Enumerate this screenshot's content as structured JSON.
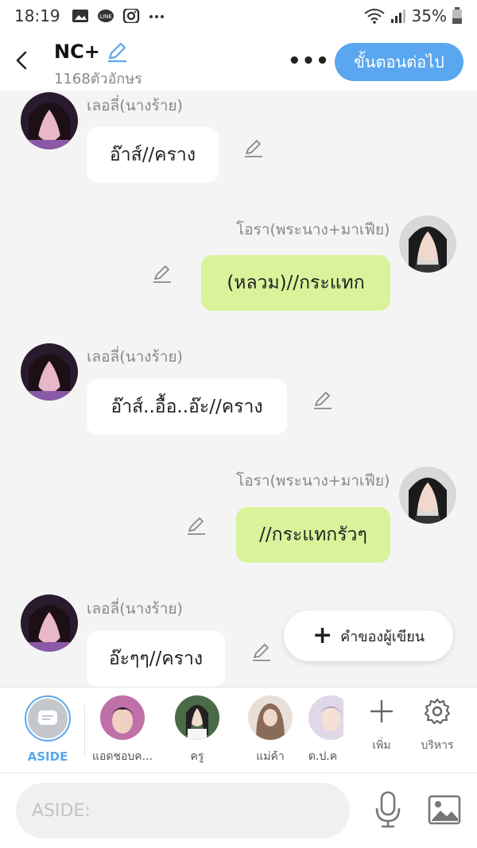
{
  "status_bar": {
    "time": "18:19",
    "battery": "35%",
    "icons": [
      "gallery-icon",
      "line-icon",
      "instagram-icon",
      "more-dots-icon",
      "wifi-icon",
      "signal-icon",
      "battery-icon"
    ]
  },
  "header": {
    "title": "NC+",
    "char_count": "1168ตัวอักษร",
    "more_label": "•••",
    "next_button": "ขั้นตอนต่อไป",
    "accent_color": "#5aa7ef"
  },
  "messages": [
    {
      "sender": "เลอลี่(นางร้าย)",
      "side": "left",
      "text": "อ๊าส์//คราง"
    },
    {
      "sender": "โอรา(พระนาง+มาเฟีย)",
      "side": "right",
      "text": "(หลวม)//กระแทก"
    },
    {
      "sender": "เลอลี่(นางร้าย)",
      "side": "left",
      "text": "อ๊าส์..อื้อ..อ๊ะ//คราง"
    },
    {
      "sender": "โอรา(พระนาง+มาเฟีย)",
      "side": "right",
      "text": "//กระแทกรัวๆ"
    },
    {
      "sender": "เลอลี่(นางร้าย)",
      "side": "left",
      "text": "อ๊ะๆๆ//คราง"
    }
  ],
  "fab": {
    "plus": "+",
    "label": "คำของผู้เขียน"
  },
  "characters": [
    {
      "name": "ASIDE"
    },
    {
      "name": "แอดชอบค..."
    },
    {
      "name": "ครู"
    },
    {
      "name": "แม่ค้า"
    },
    {
      "name": "ด.ป.ค"
    }
  ],
  "tools": {
    "add_label": "เพิ่ม",
    "manage_label": "บริหาร"
  },
  "input": {
    "placeholder": "ASIDE:"
  },
  "colors": {
    "left_bubble": "#ffffff",
    "right_bubble": "#d9f39a",
    "background": "#f4f4f4"
  }
}
